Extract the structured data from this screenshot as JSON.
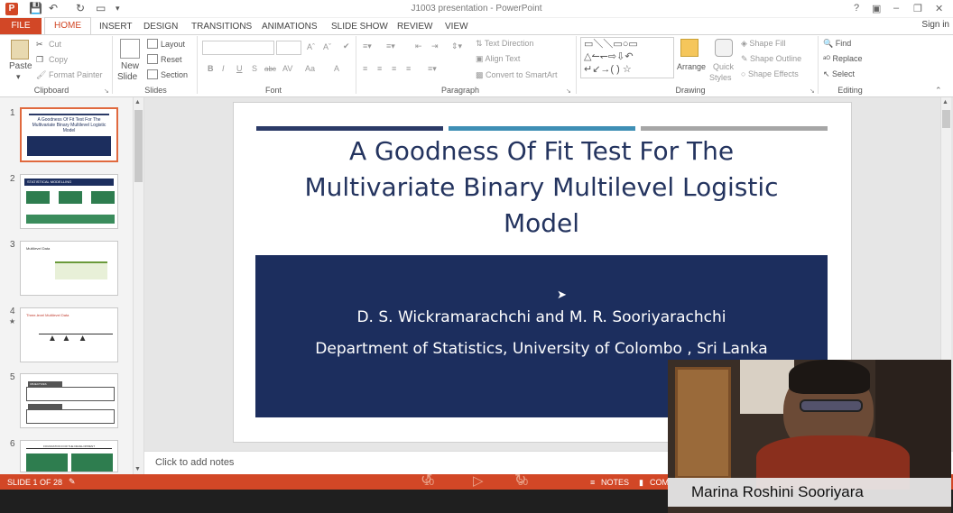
{
  "window": {
    "title": "J1003 presentation - PowerPoint",
    "app_logo": "P",
    "help": "?",
    "signin": "Sign in"
  },
  "tabs": [
    "FILE",
    "HOME",
    "INSERT",
    "DESIGN",
    "TRANSITIONS",
    "ANIMATIONS",
    "SLIDE SHOW",
    "REVIEW",
    "VIEW"
  ],
  "ribbon": {
    "clipboard": {
      "paste": "Paste",
      "cut": "Cut",
      "copy": "Copy",
      "format_painter": "Format Painter",
      "label": "Clipboard"
    },
    "slides": {
      "new_slide_1": "New",
      "new_slide_2": "Slide",
      "layout": "Layout",
      "reset": "Reset",
      "section": "Section",
      "label": "Slides"
    },
    "font": {
      "label": "Font",
      "buttons": [
        "B",
        "I",
        "U",
        "S",
        "abc",
        "AV",
        "Aa",
        "A"
      ]
    },
    "paragraph": {
      "text_direction": "Text Direction",
      "align_text": "Align Text",
      "convert_smartart": "Convert to SmartArt",
      "label": "Paragraph"
    },
    "drawing": {
      "arrange": "Arrange",
      "quick_styles_1": "Quick",
      "quick_styles_2": "Styles",
      "shape_fill": "Shape Fill",
      "shape_outline": "Shape Outline",
      "shape_effects": "Shape Effects",
      "label": "Drawing"
    },
    "editing": {
      "find": "Find",
      "replace": "Replace",
      "select": "Select",
      "label": "Editing"
    }
  },
  "thumbnails": [
    {
      "num": "1",
      "title": "A Goodness Of Fit Test For The Multivariate Binary Multilevel Logistic Model"
    },
    {
      "num": "2",
      "title": "STATISTICAL MODELLING"
    },
    {
      "num": "3",
      "title": "Multilevel Data"
    },
    {
      "num": "4",
      "title": "Three-level Multilevel Data"
    },
    {
      "num": "5",
      "title": "OBJECTIVES"
    },
    {
      "num": "6",
      "title": "FOUNDATION FOR THE DEVELOPMENT"
    }
  ],
  "slide": {
    "title_lines": [
      "A Goodness Of Fit Test For The",
      "Multivariate Binary Multilevel Logistic",
      "Model"
    ],
    "authors": "D. S. Wickramarachchi and M. R. Sooriyarachchi",
    "affiliation": "Department of Statistics, University of Colombo , Sri Lanka"
  },
  "notes_placeholder": "Click to add notes",
  "status": {
    "slide_of": "SLIDE 1 OF 28",
    "notes": "NOTES",
    "comments": "COM"
  },
  "player": {
    "back": "10",
    "forward": "30"
  },
  "webcam": {
    "name": "Marina Roshini Sooriyara"
  },
  "colors": {
    "accent": "#d24726",
    "slide_navy": "#1c2e5e",
    "title_navy": "#24345f"
  }
}
